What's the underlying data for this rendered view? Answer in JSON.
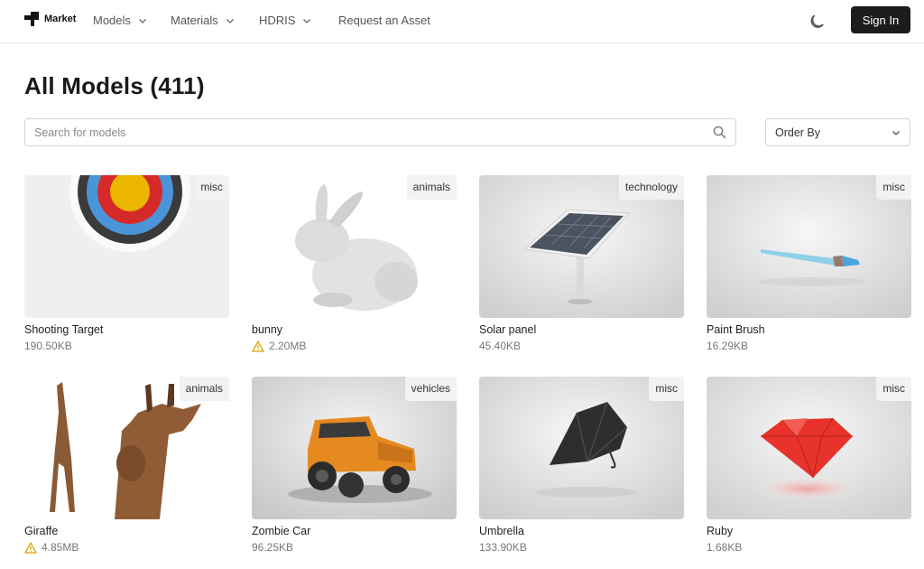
{
  "nav": {
    "brand": "Market",
    "items": [
      {
        "label": "Models",
        "dropdown": true
      },
      {
        "label": "Materials",
        "dropdown": true
      },
      {
        "label": "HDRIS",
        "dropdown": true
      },
      {
        "label": "Request an Asset",
        "dropdown": false
      }
    ],
    "theme_icon": "moon-icon",
    "signin_label": "Sign In"
  },
  "page": {
    "title": "All Models (411)"
  },
  "search": {
    "placeholder": "Search for models",
    "value": "",
    "icon": "search-icon"
  },
  "order": {
    "label": "Order By"
  },
  "colors": {
    "primary_button": "#1c1c1c",
    "warning": "#d9a200",
    "border": "#d4d4d4"
  },
  "models": [
    {
      "name": "Shooting Target",
      "size": "190.50KB",
      "category": "misc",
      "warning": false
    },
    {
      "name": "bunny",
      "size": "2.20MB",
      "category": "animals",
      "warning": true
    },
    {
      "name": "Solar panel",
      "size": "45.40KB",
      "category": "technology",
      "warning": false
    },
    {
      "name": "Paint Brush",
      "size": "16.29KB",
      "category": "misc",
      "warning": false
    },
    {
      "name": "Giraffe",
      "size": "4.85MB",
      "category": "animals",
      "warning": true
    },
    {
      "name": "Zombie Car",
      "size": "96.25KB",
      "category": "vehicles",
      "warning": false
    },
    {
      "name": "Umbrella",
      "size": "133.90KB",
      "category": "misc",
      "warning": false
    },
    {
      "name": "Ruby",
      "size": "1.68KB",
      "category": "misc",
      "warning": false
    }
  ]
}
